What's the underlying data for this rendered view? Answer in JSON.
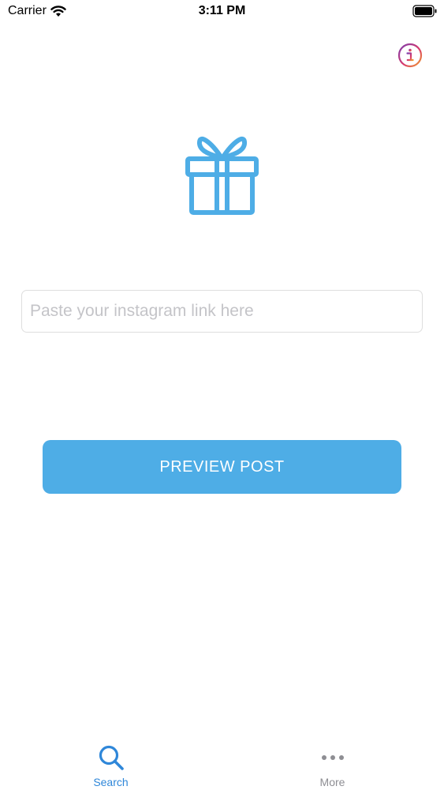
{
  "status_bar": {
    "carrier": "Carrier",
    "time": "3:11 PM",
    "wifi_icon": "wifi-icon",
    "battery_icon": "battery-icon"
  },
  "header": {
    "info_icon": "info-icon"
  },
  "hero": {
    "icon": "gift-icon",
    "color": "#4eade6"
  },
  "link_input": {
    "value": "",
    "placeholder": "Paste your instagram link here"
  },
  "preview_button": {
    "label": "PREVIEW POST",
    "color": "#4eade6"
  },
  "tab_bar": {
    "tabs": [
      {
        "label": "Search",
        "icon": "search-icon",
        "active": true,
        "color": "#2f87d9"
      },
      {
        "label": "More",
        "icon": "more-icon",
        "active": false,
        "color": "#8e8e93"
      }
    ]
  }
}
